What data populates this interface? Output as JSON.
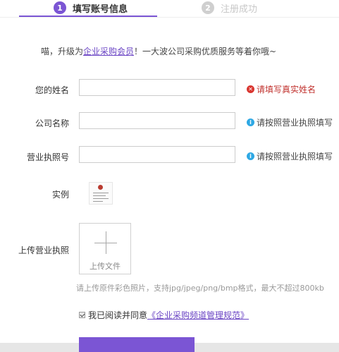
{
  "steps": [
    {
      "number": "1",
      "label": "填写账号信息",
      "state": "active"
    },
    {
      "number": "2",
      "label": "注册成功",
      "state": "inactive"
    }
  ],
  "intro": {
    "before": "喵，升级为",
    "link": "企业采购会员",
    "after": "！一大波公司采购优质服务等着你哦~"
  },
  "form": {
    "name": {
      "label": "您的姓名",
      "value": "",
      "hint": "请填写真实姓名",
      "hint_type": "error",
      "hint_icon": "error-x-icon"
    },
    "company": {
      "label": "公司名称",
      "value": "",
      "hint": "请按照营业执照填写",
      "hint_type": "info",
      "hint_icon": "info-icon"
    },
    "license": {
      "label": "营业执照号",
      "value": "",
      "hint": "请按照营业执照填写",
      "hint_type": "info",
      "hint_icon": "info-icon"
    },
    "example_label": "实例",
    "upload": {
      "label": "上传营业执照",
      "button_label": "上传文件",
      "note": "请上传原件彩色照片，支持jpg/jpeg/png/bmp格式，最大不超过800kb"
    },
    "agreement": {
      "text": "我已阅读并同意",
      "link": "《企业采购频道管理规范》",
      "checked": true
    }
  },
  "colors": {
    "accent": "#7b55d4",
    "error": "#d9352f",
    "info": "#2ea8e4"
  }
}
